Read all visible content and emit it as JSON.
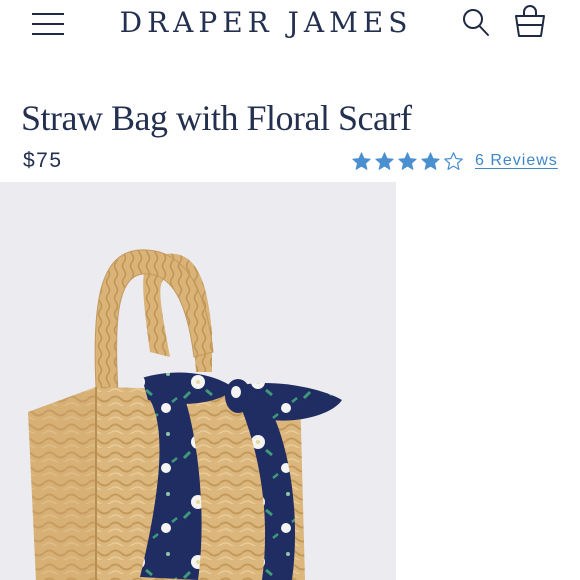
{
  "header": {
    "brand": "DRAPER JAMES",
    "menu_icon": "hamburger-menu-icon",
    "search_icon": "search-icon",
    "bag_icon": "shopping-bag-icon"
  },
  "product": {
    "title": "Straw Bag with Floral Scarf",
    "price": "$75",
    "rating": 4,
    "rating_max": 5,
    "reviews_label": "6 Reviews"
  },
  "colors": {
    "brand_navy": "#24304f",
    "star_blue": "#4a8fd0",
    "link_blue": "#3f86c9",
    "image_bg": "#ecebef"
  }
}
